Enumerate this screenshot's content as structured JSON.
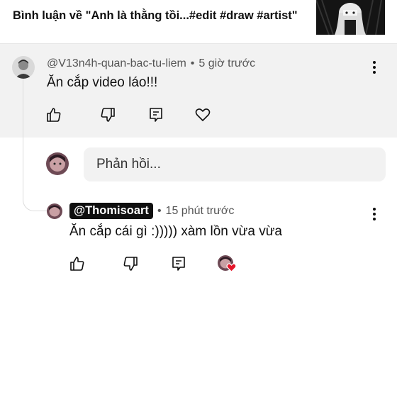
{
  "header": {
    "title": "Bình luận về \"Anh là thằng tồi...#edit #draw #artist\""
  },
  "comment": {
    "author": "@V13n4h-quan-bac-tu-liem",
    "time": "5 giờ trước",
    "text": "Ăn cắp video láo!!!",
    "icons": [
      "like-icon",
      "dislike-icon",
      "reply-icon",
      "heart-icon",
      "more-vert-icon"
    ]
  },
  "reply_input": {
    "placeholder": "Phản hồi..."
  },
  "reply": {
    "author": "@Thomisoart",
    "time": "15 phút trước",
    "text": "Ăn cắp cái gì :))))) xàm lồn vừa vừa",
    "icons": [
      "like-icon",
      "dislike-icon",
      "reply-icon",
      "creator-heart-icon",
      "more-vert-icon"
    ]
  },
  "colors": {
    "highlight_bg": "#f2f2f2",
    "chip_bg": "#0f0f0f",
    "heart": "#e5162a"
  }
}
